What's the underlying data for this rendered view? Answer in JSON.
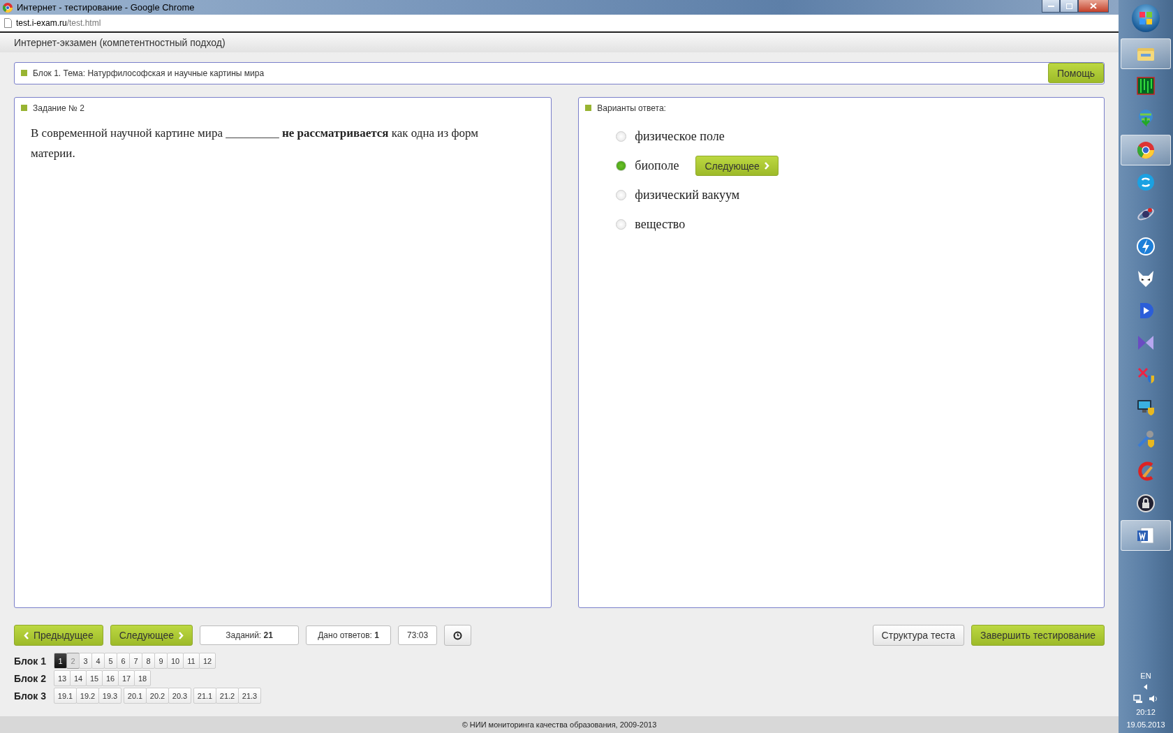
{
  "window": {
    "title": "Интернет - тестирование - Google Chrome"
  },
  "address": {
    "host": "test.i-exam.ru",
    "path": "/test.html"
  },
  "header": {
    "title": "Интернет-экзамен (компетентностный подход)"
  },
  "topic": {
    "text": "Блок 1. Тема: Натурфилософская и научные картины мира",
    "help_button": "Помощь"
  },
  "task": {
    "title": "Задание № 2",
    "question": "В современной научной картине мира _________ **не рассматривается** как одна из форм материи."
  },
  "answers": {
    "title": "Варианты ответа:",
    "options": [
      {
        "label": "физическое поле",
        "selected": false
      },
      {
        "label": "биополе",
        "selected": true,
        "next_button": "Следующее"
      },
      {
        "label": "физический вакуум",
        "selected": false
      },
      {
        "label": "вещество",
        "selected": false
      }
    ]
  },
  "controls": {
    "prev": "Предыдущее",
    "next": "Следующее",
    "tasks_count": "Заданий: **21**",
    "answered_count": "Дано ответов: **1**",
    "timer": "73:03",
    "structure": "Структура теста",
    "finish": "Завершить тестирование"
  },
  "blocks": [
    {
      "label": "Блок 1",
      "groups": [
        [
          {
            "n": "1",
            "answered": true,
            "selected": false
          },
          {
            "n": "2",
            "answered": false,
            "selected": true
          },
          {
            "n": "3",
            "answered": false,
            "selected": false
          },
          {
            "n": "4",
            "answered": false,
            "selected": false
          },
          {
            "n": "5",
            "answered": false,
            "selected": false
          },
          {
            "n": "6",
            "answered": false,
            "selected": false
          },
          {
            "n": "7",
            "answered": false,
            "selected": false
          },
          {
            "n": "8",
            "answered": false,
            "selected": false
          },
          {
            "n": "9",
            "answered": false,
            "selected": false
          },
          {
            "n": "10",
            "answered": false,
            "selected": false
          },
          {
            "n": "11",
            "answered": false,
            "selected": false
          },
          {
            "n": "12",
            "answered": false,
            "selected": false
          }
        ]
      ]
    },
    {
      "label": "Блок 2",
      "groups": [
        [
          {
            "n": "13",
            "answered": false,
            "selected": false
          },
          {
            "n": "14",
            "answered": false,
            "selected": false
          },
          {
            "n": "15",
            "answered": false,
            "selected": false
          },
          {
            "n": "16",
            "answered": false,
            "selected": false
          },
          {
            "n": "17",
            "answered": false,
            "selected": false
          },
          {
            "n": "18",
            "answered": false,
            "selected": false
          }
        ]
      ]
    },
    {
      "label": "Блок 3",
      "groups": [
        [
          {
            "n": "19.1",
            "answered": false,
            "selected": false
          },
          {
            "n": "19.2",
            "answered": false,
            "selected": false
          },
          {
            "n": "19.3",
            "answered": false,
            "selected": false
          }
        ],
        [
          {
            "n": "20.1",
            "answered": false,
            "selected": false
          },
          {
            "n": "20.2",
            "answered": false,
            "selected": false
          },
          {
            "n": "20.3",
            "answered": false,
            "selected": false
          }
        ],
        [
          {
            "n": "21.1",
            "answered": false,
            "selected": false
          },
          {
            "n": "21.2",
            "answered": false,
            "selected": false
          },
          {
            "n": "21.3",
            "answered": false,
            "selected": false
          }
        ]
      ]
    }
  ],
  "footer": "© НИИ мониторинга качества образования, 2009-2013",
  "taskbar": {
    "apps": [
      {
        "kind": "folder",
        "running": true
      },
      {
        "kind": "matrix",
        "running": false
      },
      {
        "kind": "download",
        "running": false
      },
      {
        "kind": "chrome",
        "running": true
      },
      {
        "kind": "chat",
        "running": false
      },
      {
        "kind": "atom",
        "running": false
      },
      {
        "kind": "bolt",
        "running": false
      },
      {
        "kind": "fox",
        "running": false
      },
      {
        "kind": "play",
        "running": false
      },
      {
        "kind": "bowtie",
        "running": false
      },
      {
        "kind": "tools-shield",
        "running": false
      },
      {
        "kind": "monitor",
        "running": false
      },
      {
        "kind": "wrench",
        "running": false
      },
      {
        "kind": "brush",
        "running": false
      },
      {
        "kind": "lock",
        "running": false
      },
      {
        "kind": "document",
        "running": true
      }
    ],
    "language": "EN",
    "time": "20:12",
    "date": "19.05.2013"
  }
}
